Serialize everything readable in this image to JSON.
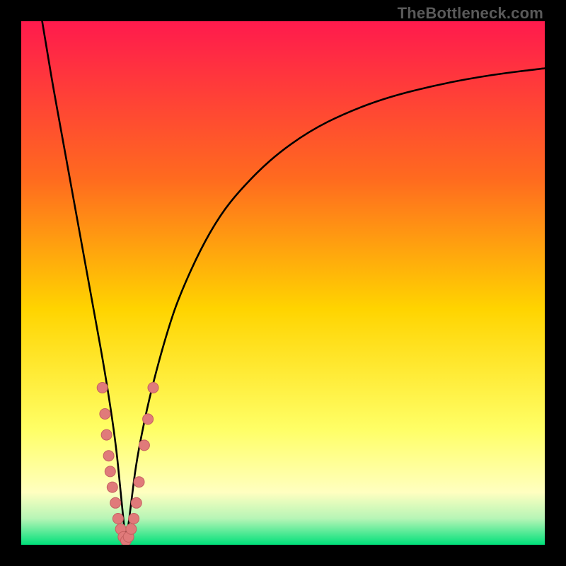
{
  "watermark": "TheBottleneck.com",
  "colors": {
    "frame": "#000000",
    "gradient_top": "#ff1a4d",
    "gradient_mid1": "#ff6a1f",
    "gradient_mid2": "#ffd400",
    "gradient_mid3": "#ffff66",
    "gradient_mid4": "#ffffc0",
    "gradient_bottom_light": "#b6f5b6",
    "gradient_bottom": "#00e07a",
    "curve": "#000000",
    "dot_fill": "#e07a7a",
    "dot_stroke": "#c46060"
  },
  "chart_data": {
    "type": "line",
    "title": "",
    "xlabel": "",
    "ylabel": "",
    "xlim": [
      0,
      100
    ],
    "ylim": [
      0,
      100
    ],
    "x_optimum": 20,
    "series": [
      {
        "name": "bottleneck-curve",
        "x": [
          4,
          5,
          6,
          8,
          10,
          12,
          14,
          16,
          18,
          19,
          20,
          21,
          22,
          24,
          26,
          28,
          30,
          34,
          38,
          42,
          48,
          55,
          62,
          70,
          80,
          90,
          100
        ],
        "y": [
          100,
          94,
          88,
          77,
          66,
          55,
          44,
          33,
          20,
          10,
          0,
          8,
          16,
          26,
          34,
          41,
          47,
          56,
          63,
          68,
          74,
          79,
          82.5,
          85.5,
          88,
          89.8,
          91
        ]
      }
    ],
    "dot_cluster": {
      "name": "sample-points",
      "points": [
        {
          "x": 15.5,
          "y": 30
        },
        {
          "x": 16.0,
          "y": 25
        },
        {
          "x": 16.3,
          "y": 21
        },
        {
          "x": 16.7,
          "y": 17
        },
        {
          "x": 17.0,
          "y": 14
        },
        {
          "x": 17.4,
          "y": 11
        },
        {
          "x": 18.0,
          "y": 8
        },
        {
          "x": 18.5,
          "y": 5
        },
        {
          "x": 19.0,
          "y": 3
        },
        {
          "x": 19.5,
          "y": 1.5
        },
        {
          "x": 20.0,
          "y": 0.8
        },
        {
          "x": 20.5,
          "y": 1.5
        },
        {
          "x": 21.0,
          "y": 3
        },
        {
          "x": 21.5,
          "y": 5
        },
        {
          "x": 22.0,
          "y": 8
        },
        {
          "x": 22.5,
          "y": 12
        },
        {
          "x": 23.5,
          "y": 19
        },
        {
          "x": 24.2,
          "y": 24
        },
        {
          "x": 25.2,
          "y": 30
        }
      ]
    }
  }
}
